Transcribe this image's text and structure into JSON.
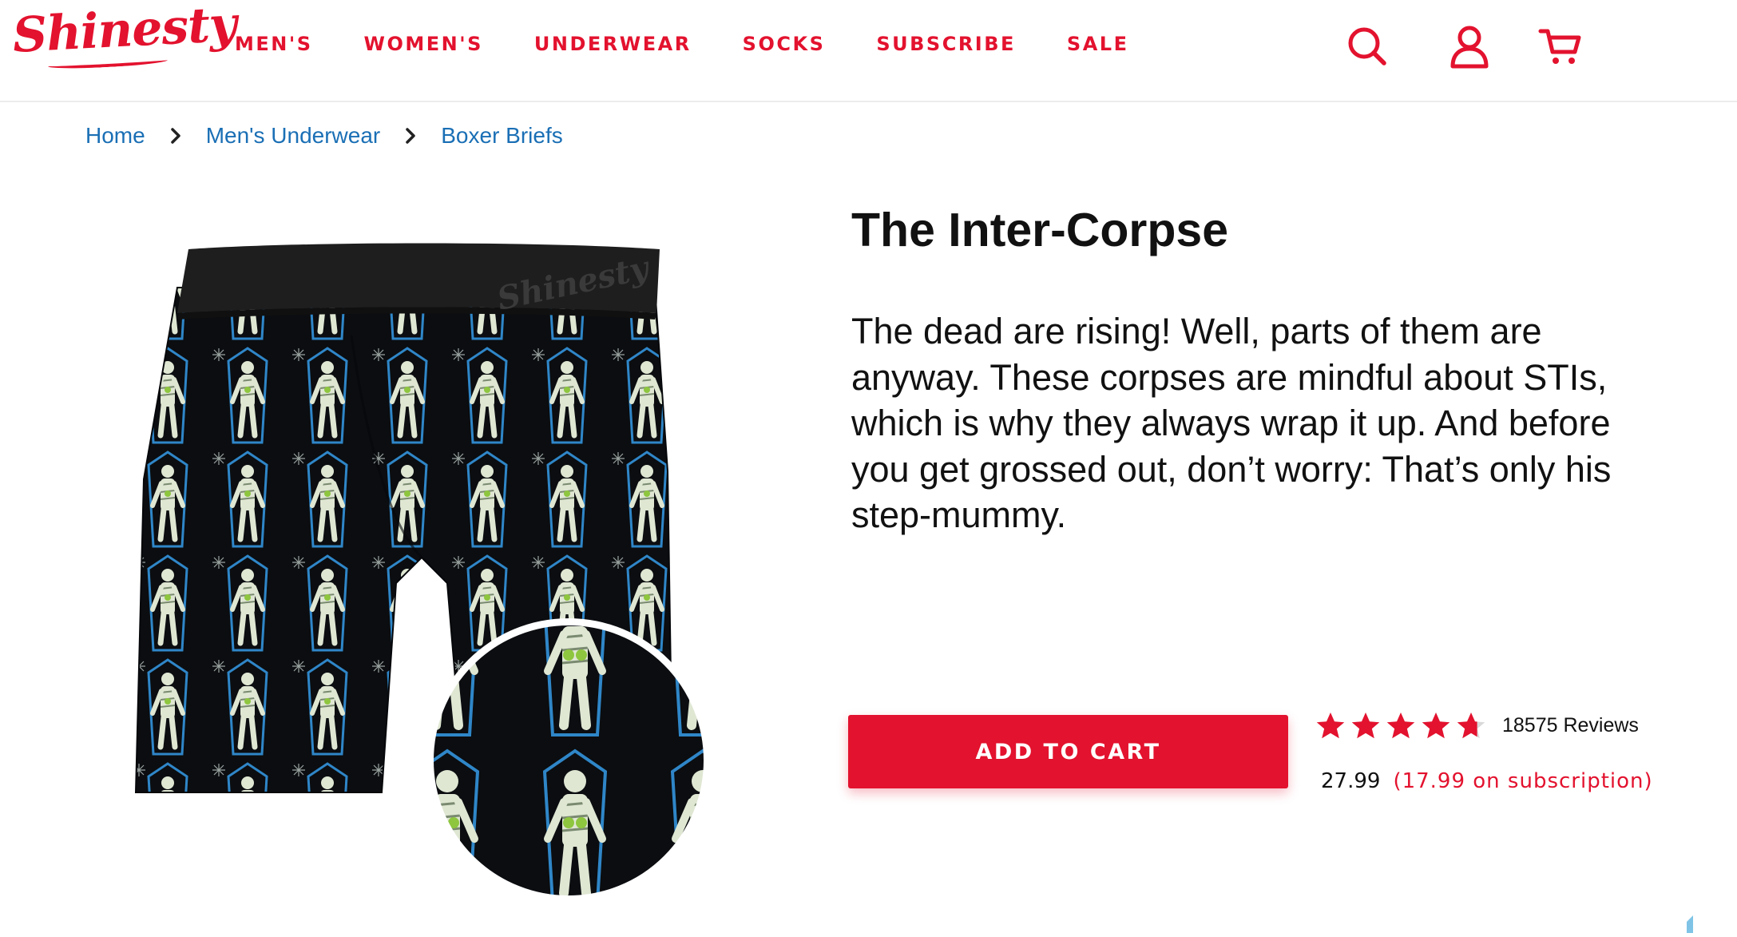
{
  "brand": {
    "logo_text": "Shinesty",
    "accent_color": "#e3122e",
    "link_color": "#1a6fb5"
  },
  "nav": {
    "items": [
      {
        "label": "MEN'S"
      },
      {
        "label": "WOMEN'S"
      },
      {
        "label": "UNDERWEAR"
      },
      {
        "label": "SOCKS"
      },
      {
        "label": "SUBSCRIBE"
      },
      {
        "label": "SALE"
      }
    ]
  },
  "header_icons": [
    "search-icon",
    "account-icon",
    "cart-icon"
  ],
  "breadcrumb": {
    "items": [
      {
        "label": "Home"
      },
      {
        "label": "Men's Underwear"
      },
      {
        "label": "Boxer Briefs"
      }
    ],
    "separator_icon": "chevron-right-icon"
  },
  "product": {
    "image_alt": "Boxer briefs with mummy and coffin print",
    "waistband_text": "Shinesty",
    "title": "The Inter-Corpse",
    "description": "The dead are rising! Well, parts of them are anyway. These corpses are mindful about STIs, which is why they always wrap it up. And before you get grossed out, don’t worry: That’s only his step-mummy.",
    "add_to_cart_label": "ADD TO CART",
    "rating": 4.7,
    "rating_max": 5,
    "review_count_label": "18575 Reviews",
    "price": "27.99",
    "subscription_price": "(17.99 on subscription)"
  }
}
